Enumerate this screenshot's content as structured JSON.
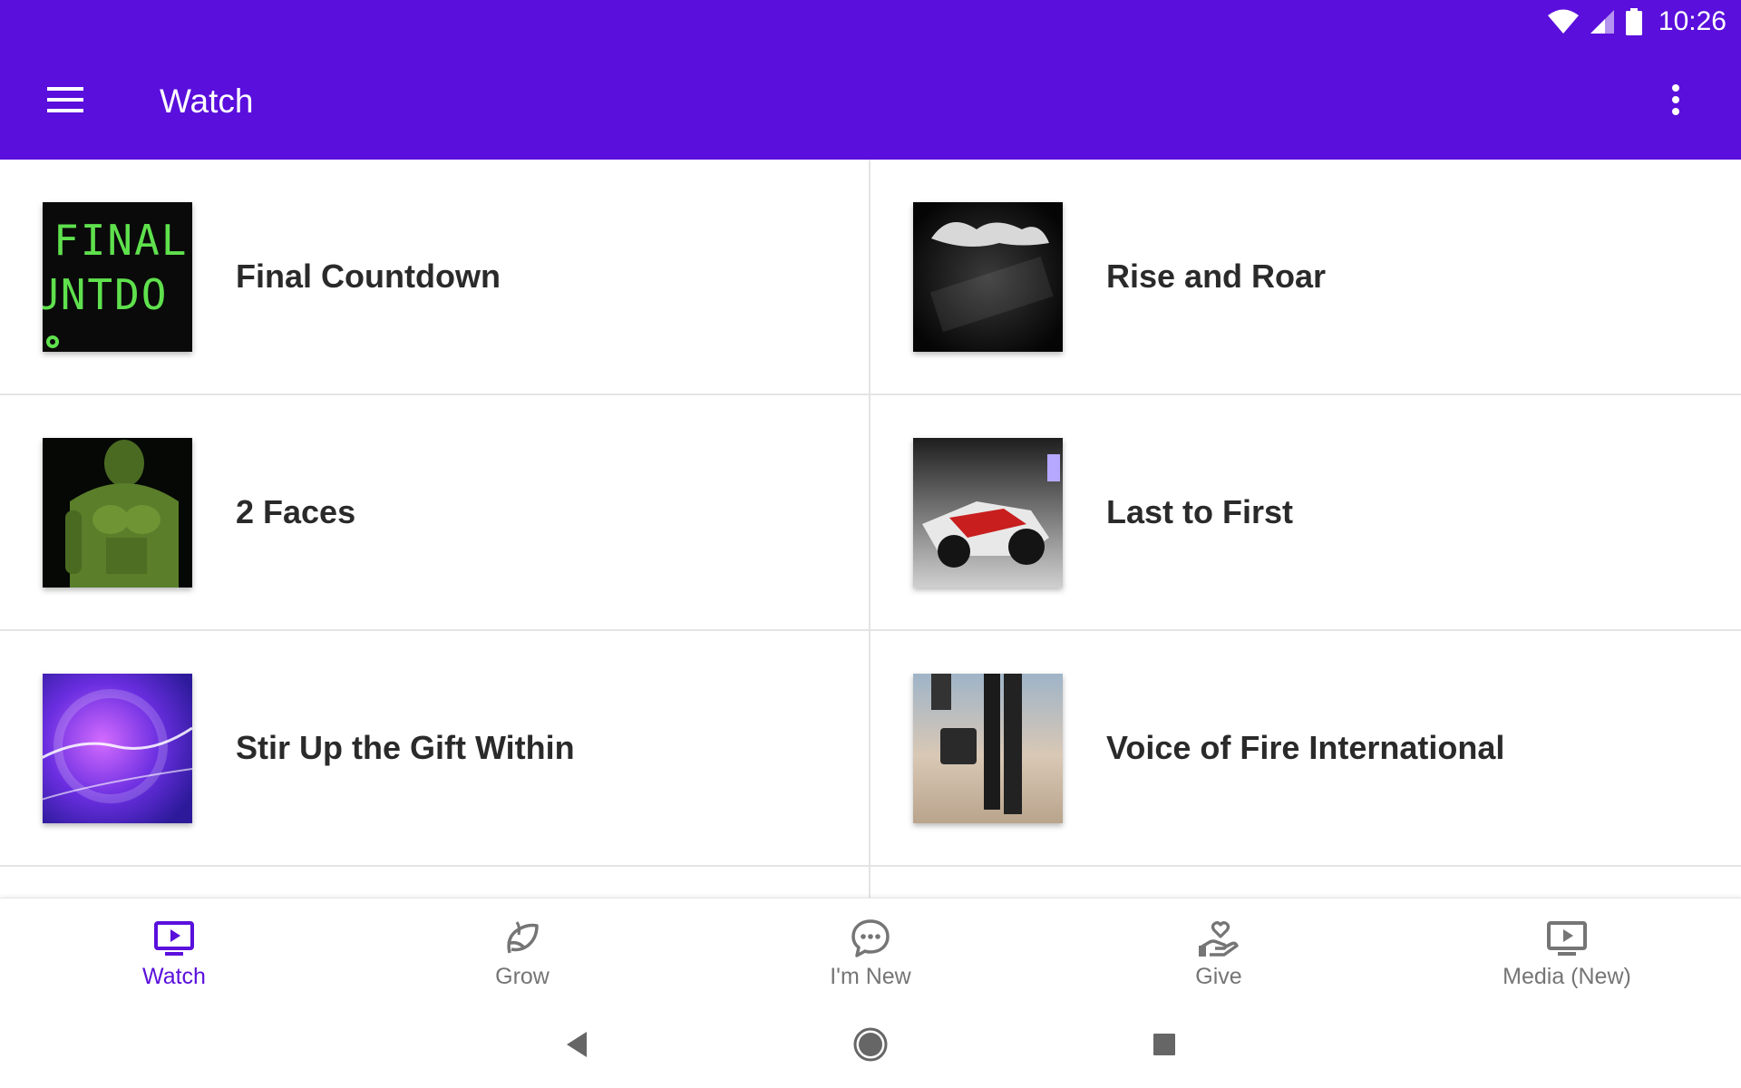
{
  "status_bar": {
    "time": "10:26",
    "icons": [
      "wifi-icon",
      "cell-signal-icon",
      "battery-icon"
    ]
  },
  "app_bar": {
    "title": "Watch",
    "menu_icon": "hamburger-menu-icon",
    "overflow_icon": "more-vert-icon",
    "background_color": "#5a0fdc"
  },
  "items": [
    {
      "title": "Final Countdown",
      "thumbnail": "final-countdown-thumbnail"
    },
    {
      "title": "Rise and Roar",
      "thumbnail": "rise-and-roar-thumbnail"
    },
    {
      "title": "2 Faces",
      "thumbnail": "2-faces-thumbnail"
    },
    {
      "title": "Last to First",
      "thumbnail": "last-to-first-thumbnail"
    },
    {
      "title": "Stir Up the Gift Within",
      "thumbnail": "stir-up-the-gift-within-thumbnail"
    },
    {
      "title": "Voice of Fire International",
      "thumbnail": "voice-of-fire-thumbnail"
    }
  ],
  "bottom_nav": {
    "active_color": "#5a0fdc",
    "inactive_color": "#757575",
    "items": [
      {
        "label": "Watch",
        "icon": "tv-play-icon",
        "active": true
      },
      {
        "label": "Grow",
        "icon": "leaf-hand-icon",
        "active": false
      },
      {
        "label": "I'm New",
        "icon": "chat-bubble-icon",
        "active": false
      },
      {
        "label": "Give",
        "icon": "heart-hand-icon",
        "active": false
      },
      {
        "label": "Media (New)",
        "icon": "tv-play-icon",
        "active": false
      }
    ]
  },
  "system_nav": {
    "icons": [
      "back-icon",
      "home-icon",
      "recents-icon"
    ]
  }
}
